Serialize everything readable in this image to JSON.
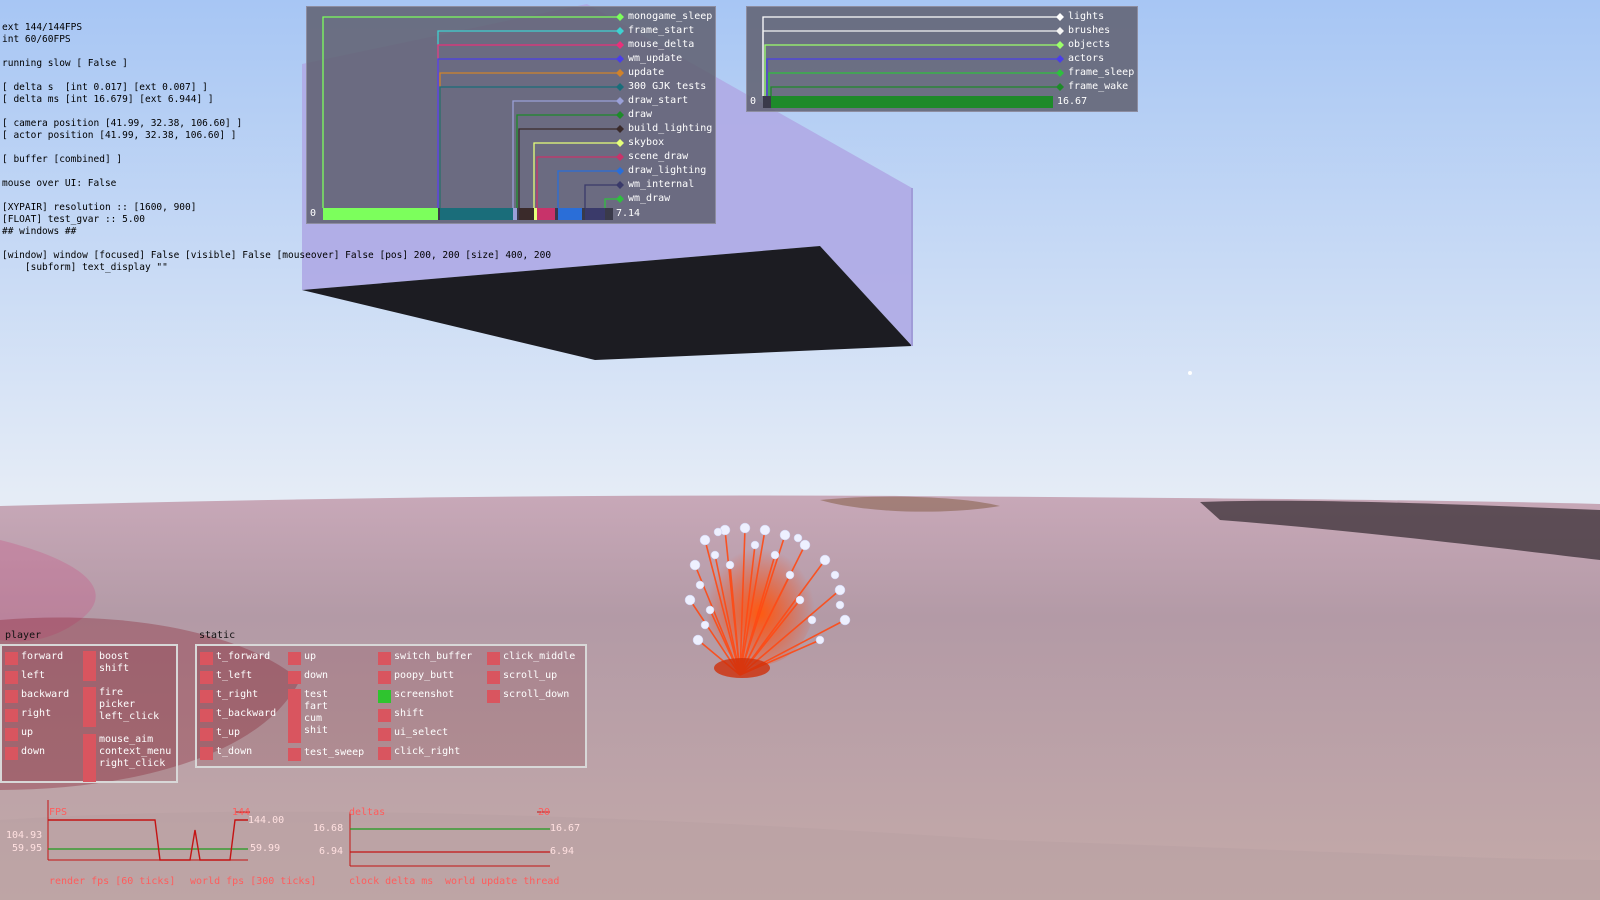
{
  "debug": {
    "lines": [
      "ext 144/144FPS",
      "int 60/60FPS",
      "",
      "running slow [ False ]",
      "",
      "[ delta s  [int 0.017] [ext 0.007] ]",
      "[ delta ms [int 16.679] [ext 6.944] ]",
      "",
      "[ camera position [41.99, 32.38, 106.60] ]",
      "[ actor position [41.99, 32.38, 106.60] ]",
      "",
      "[ buffer [combined] ]",
      "",
      "mouse over UI: False",
      "",
      "[XYPAIR] resolution :: [1600, 900]",
      "[FLOAT] test_gvar :: 5.00",
      "## windows ##",
      "",
      "[window] window [focused] False [visible] False [mouseover] False [pos] 200, 200 [size] 400, 200",
      "    [subform] text_display \"\""
    ]
  },
  "profiler_main": {
    "zero_label": "0",
    "total_label": "7.14",
    "entries": [
      {
        "label": "monogame_sleep",
        "color": "#7cff5c"
      },
      {
        "label": "frame_start",
        "color": "#3fd1d1"
      },
      {
        "label": "mouse_delta",
        "color": "#e8307a"
      },
      {
        "label": "wm_update",
        "color": "#4a3ee8"
      },
      {
        "label": "update",
        "color": "#d0822a"
      },
      {
        "label": "300 GJK tests",
        "color": "#1a6d7a"
      },
      {
        "label": "draw_start",
        "color": "#9aa0d8"
      },
      {
        "label": "draw",
        "color": "#1e8a2a"
      },
      {
        "label": "build_lighting",
        "color": "#3a2a2a"
      },
      {
        "label": "skybox",
        "color": "#e6ff7a"
      },
      {
        "label": "scene_draw",
        "color": "#c8336a"
      },
      {
        "label": "draw_lighting",
        "color": "#2a6ed8"
      },
      {
        "label": "wm_internal",
        "color": "#3a3a6a"
      },
      {
        "label": "wm_draw",
        "color": "#2fbf3f"
      }
    ]
  },
  "profiler_world": {
    "zero_label": "0",
    "total_label": "16.67",
    "entries": [
      {
        "label": "lights",
        "color": "#ffffff"
      },
      {
        "label": "brushes",
        "color": "#f4f4f4"
      },
      {
        "label": "objects",
        "color": "#9cff6a"
      },
      {
        "label": "actors",
        "color": "#4a3ee8"
      },
      {
        "label": "frame_sleep",
        "color": "#2fbf3f"
      },
      {
        "label": "frame_wake",
        "color": "#1e8a2a"
      }
    ]
  },
  "input": {
    "player_title": "player",
    "static_title": "static",
    "player_keys": [
      {
        "label": "forward",
        "active": false
      },
      {
        "label": "left",
        "active": false
      },
      {
        "label": "backward",
        "active": false
      },
      {
        "label": "right",
        "active": false
      },
      {
        "label": "up",
        "active": false
      },
      {
        "label": "down",
        "active": false
      }
    ],
    "player_multi": [
      {
        "lines": "boost\nshift"
      },
      {
        "lines": "fire\npicker\nleft_click"
      },
      {
        "lines": "mouse_aim\ncontext_menu\nright_click"
      }
    ],
    "static_col1": [
      {
        "label": "t_forward"
      },
      {
        "label": "t_left"
      },
      {
        "label": "t_right"
      },
      {
        "label": "t_backward"
      },
      {
        "label": "t_up"
      },
      {
        "label": "t_down"
      }
    ],
    "static_col2": [
      {
        "label": "up"
      },
      {
        "label": "down"
      }
    ],
    "static_col2_multi": {
      "lines": "test\nfart\ncum\nshit"
    },
    "static_col2_last": {
      "label": "test_sweep"
    },
    "static_col3": [
      {
        "label": "switch_buffer",
        "active": false
      },
      {
        "label": "poopy_butt",
        "active": false
      },
      {
        "label": "screenshot",
        "active": true
      },
      {
        "label": "shift",
        "active": false
      },
      {
        "label": "ui_select",
        "active": false
      },
      {
        "label": "click_right",
        "active": false
      }
    ],
    "static_col4": [
      {
        "label": "click_middle"
      },
      {
        "label": "scroll_up"
      },
      {
        "label": "scroll_down"
      }
    ]
  },
  "graphs": {
    "fps": {
      "title": "FPS",
      "max_label": "144",
      "val_top_right": "144.00",
      "val_left_top": "104.93",
      "val_left_mid": "59.95",
      "val_right_mid": "59.99",
      "legend_render": "render fps [60 ticks]",
      "legend_world": "world fps [300 ticks]"
    },
    "deltas": {
      "title": "deltas",
      "max_label": "20",
      "val_left_top": "16.68",
      "val_right_top": "16.67",
      "val_left_bottom": "6.94",
      "val_right_bottom": "6.94",
      "legend_clock": "clock delta ms",
      "legend_world": "world update thread"
    }
  },
  "colors": {
    "sky_top": "#a8c8f5",
    "sky_bottom": "#e4ecf7",
    "cube": "#b0ace6",
    "graph_red": "#c41414",
    "graph_green": "#1f9a1f"
  }
}
